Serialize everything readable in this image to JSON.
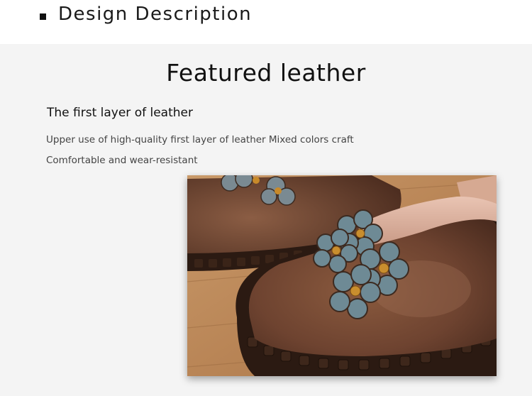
{
  "header": {
    "title": "Design Description"
  },
  "feature": {
    "title": "Featured leather",
    "subheading": "The first layer of leather",
    "lines": [
      "Upper use of high-quality first layer of leather  Mixed colors craft",
      "Comfortable and wear-resistant"
    ]
  },
  "photo": {
    "subject": "brown-leather-flower-shoes"
  }
}
